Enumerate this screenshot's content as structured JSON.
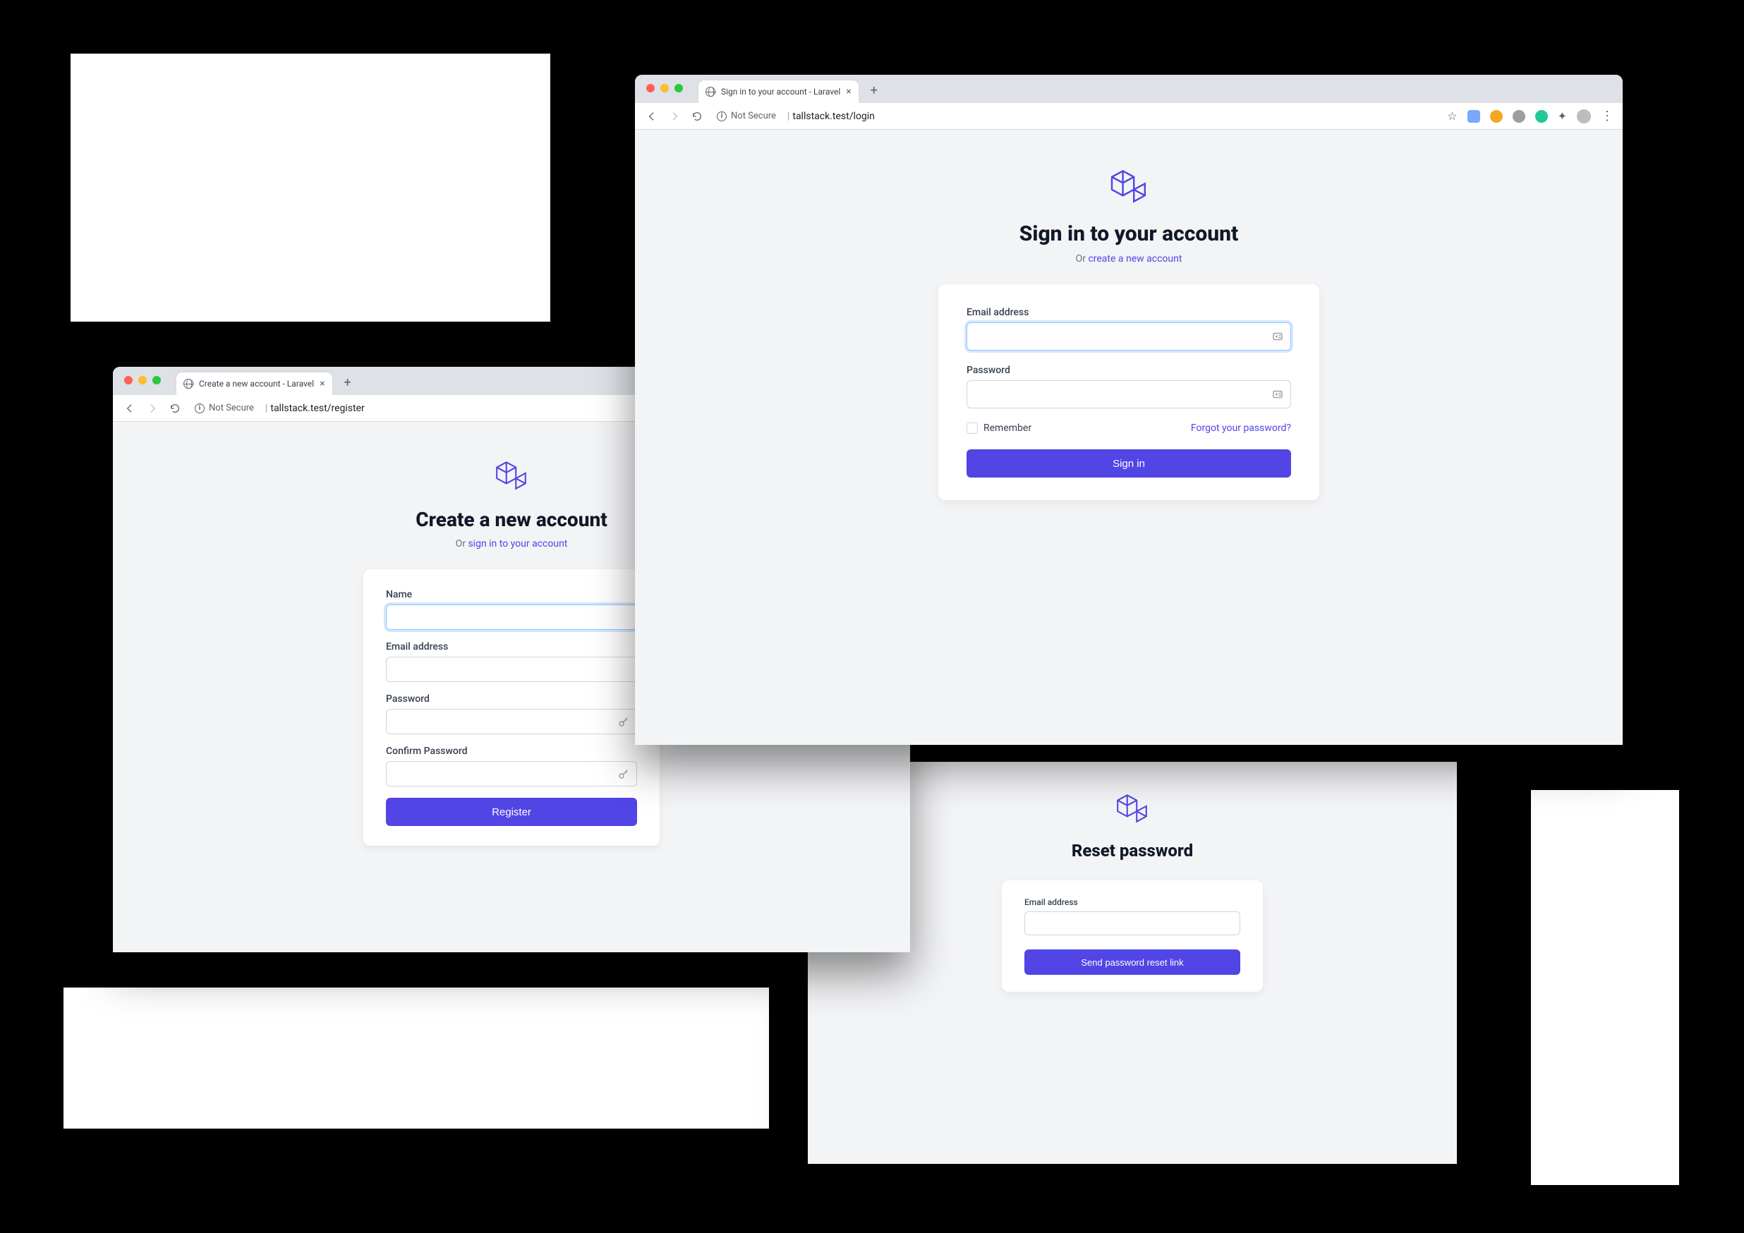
{
  "login": {
    "tab_title": "Sign in to your account - Laravel",
    "security_label": "Not Secure",
    "url_display": "tallstack.test/login",
    "heading": "Sign in to your account",
    "sub_prefix": "Or ",
    "sub_link": "create a new account",
    "fields": {
      "email_label": "Email address",
      "password_label": "Password",
      "remember_label": "Remember",
      "forgot_link": "Forgot your password?"
    },
    "button": "Sign in"
  },
  "register": {
    "tab_title": "Create a new account - Laravel",
    "security_label": "Not Secure",
    "url_display": "tallstack.test/register",
    "heading": "Create a new account",
    "sub_prefix": "Or ",
    "sub_link": "sign in to your account",
    "fields": {
      "name_label": "Name",
      "email_label": "Email address",
      "password_label": "Password",
      "confirm_label": "Confirm Password"
    },
    "button": "Register"
  },
  "reset": {
    "heading": "Reset password",
    "fields": {
      "email_label": "Email address"
    },
    "button": "Send password reset link"
  },
  "extension_colors": [
    "#7aa8ff",
    "#f5a623",
    "#9e9e9e",
    "#20c997"
  ]
}
